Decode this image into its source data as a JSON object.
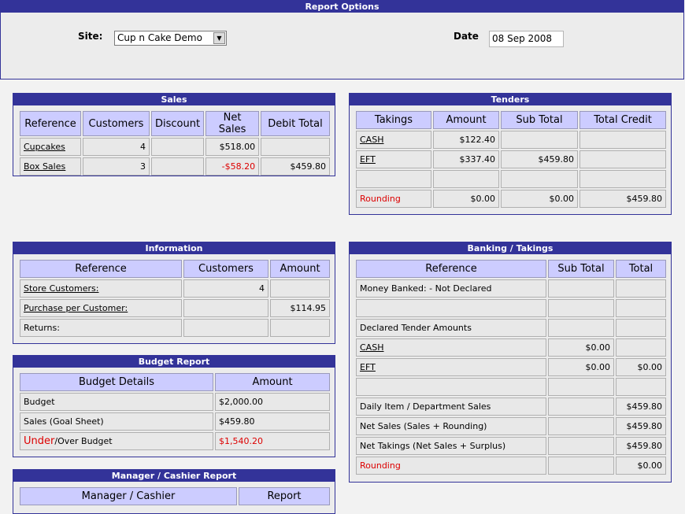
{
  "report_options": {
    "title": "Report Options",
    "site_label": "Site:",
    "site_value": "Cup n Cake Demo",
    "date_label": "Date",
    "date_value": "08 Sep 2008"
  },
  "sales": {
    "title": "Sales",
    "headers": [
      "Reference",
      "Customers",
      "Discount",
      "Net Sales",
      "Debit Total"
    ],
    "rows": [
      {
        "reference": "Cupcakes",
        "customers": "4",
        "discount": "",
        "net_sales": "$518.00",
        "debit_total": ""
      },
      {
        "reference": "Box Sales",
        "customers": "3",
        "discount": "",
        "net_sales": "-$58.20",
        "debit_total": "$459.80"
      }
    ]
  },
  "tenders": {
    "title": "Tenders",
    "headers": [
      "Takings",
      "Amount",
      "Sub Total",
      "Total Credit"
    ],
    "rows": [
      {
        "takings": "CASH",
        "amount": "$122.40",
        "sub_total": "",
        "total_credit": ""
      },
      {
        "takings": "EFT",
        "amount": "$337.40",
        "sub_total": "$459.80",
        "total_credit": ""
      },
      {
        "takings": "",
        "amount": "",
        "sub_total": "",
        "total_credit": ""
      },
      {
        "takings": "Rounding",
        "amount": "$0.00",
        "sub_total": "$0.00",
        "total_credit": "$459.80"
      }
    ]
  },
  "information": {
    "title": "Information",
    "headers": [
      "Reference",
      "Customers",
      "Amount"
    ],
    "rows": [
      {
        "reference": "Store Customers:",
        "customers": "4",
        "amount": ""
      },
      {
        "reference": "Purchase per Customer:",
        "customers": "",
        "amount": "$114.95"
      },
      {
        "reference": "Returns:",
        "customers": "",
        "amount": ""
      }
    ]
  },
  "budget": {
    "title": "Budget Report",
    "headers": [
      "Budget Details",
      "Amount"
    ],
    "rows": [
      {
        "details": "Budget",
        "amount": "$2,000.00"
      },
      {
        "details": "Sales (Goal Sheet)",
        "amount": "$459.80"
      }
    ],
    "under_label": "Under",
    "over_label": "/Over Budget",
    "under_over_amount": "$1,540.20"
  },
  "manager": {
    "title": "Manager / Cashier Report",
    "headers": [
      "Manager / Cashier",
      "Report"
    ]
  },
  "banking": {
    "title": "Banking / Takings",
    "headers": [
      "Reference",
      "Sub Total",
      "Total"
    ],
    "rows": [
      {
        "reference": "Money Banked: - Not Declared",
        "sub_total": "",
        "total": ""
      },
      {
        "reference": "",
        "sub_total": "",
        "total": ""
      },
      {
        "reference": "Declared Tender Amounts",
        "sub_total": "",
        "total": ""
      },
      {
        "reference": "CASH",
        "sub_total": "$0.00",
        "total": ""
      },
      {
        "reference": "EFT",
        "sub_total": "$0.00",
        "total": "$0.00"
      },
      {
        "reference": "",
        "sub_total": "",
        "total": ""
      },
      {
        "reference": "Daily Item / Department Sales",
        "sub_total": "",
        "total": "$459.80"
      },
      {
        "reference": "Net Sales (Sales + Rounding)",
        "sub_total": "",
        "total": "$459.80"
      },
      {
        "reference": "Net Takings (Net Sales + Surplus)",
        "sub_total": "",
        "total": "$459.80"
      },
      {
        "reference": "Rounding",
        "sub_total": "",
        "total": "$0.00"
      }
    ]
  },
  "colors": {
    "header_bar": "#333399",
    "column_header": "#ccccff",
    "cell": "#e8e8e8",
    "negative": "#dd0000"
  }
}
